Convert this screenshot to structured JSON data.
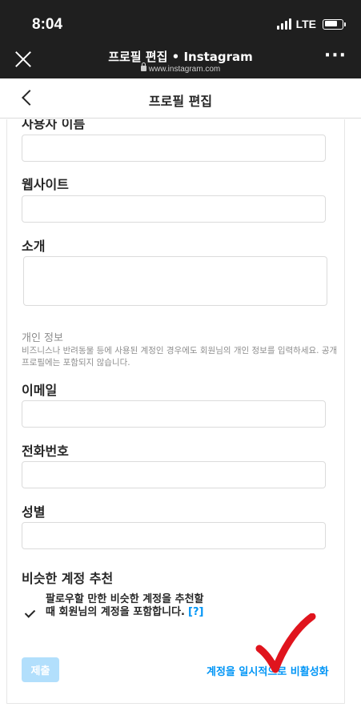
{
  "status_bar": {
    "time": "8:04",
    "network": "LTE"
  },
  "browser": {
    "title": "프로필 편집 • Instagram",
    "url": "www.instagram.com",
    "close_icon": "close-icon",
    "more_icon": "more-icon"
  },
  "header": {
    "title": "프로필 편집",
    "back_icon": "chevron-left-icon"
  },
  "form": {
    "username_label": "사용자 이름",
    "website_label": "웹사이트",
    "bio_label": "소개",
    "personal_info_title": "개인 정보",
    "personal_info_desc": "비즈니스나 반려동물 등에 사용된 계정인 경우에도 회원님의 개인 정보를 입력하세요. 공개 프로필에는 포함되지 않습니다.",
    "email_label": "이메일",
    "phone_label": "전화번호",
    "gender_label": "성별",
    "similar_title": "비슷한 계정 추천",
    "similar_text": "팔로우할 만한 비슷한 계정을 추천할 때 회원님의 계정을 포함합니다.",
    "help_link": "[?]",
    "similar_checked": true,
    "submit_label": "제출",
    "deactivate_label": "계정을 일시적으로 비활성화"
  },
  "colors": {
    "accent": "#0095f6",
    "submit_disabled": "#b2dffc",
    "annotation": "#e0141d"
  }
}
